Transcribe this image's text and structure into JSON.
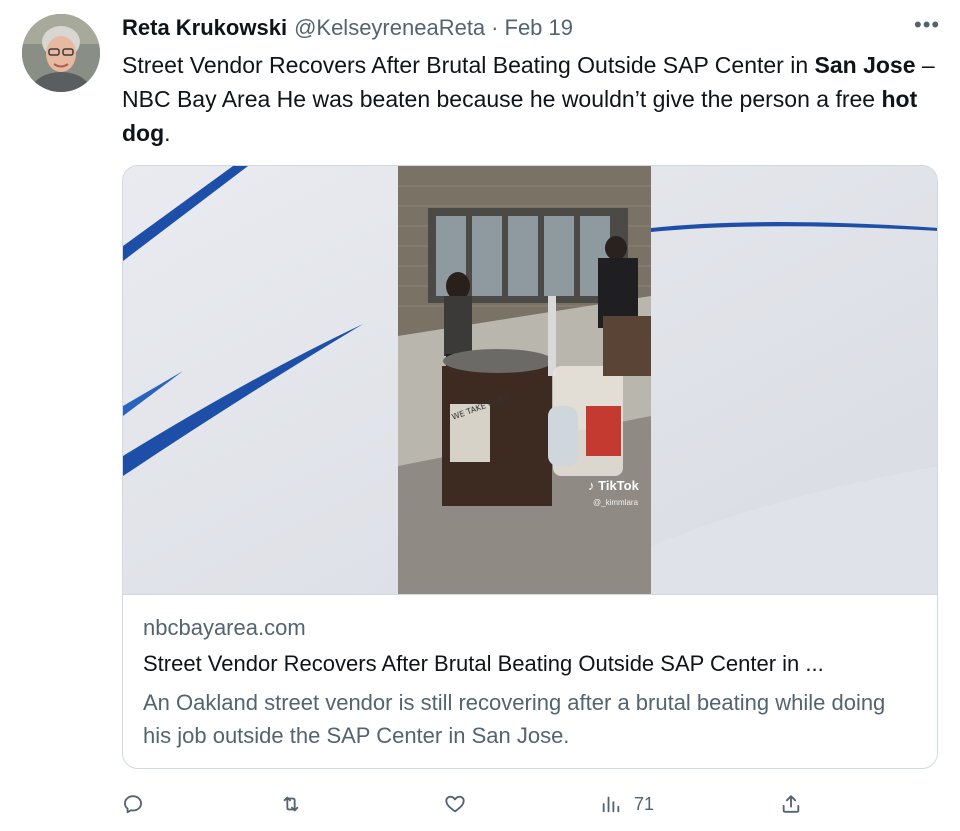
{
  "tweet": {
    "author_name": "Reta Krukowski",
    "author_handle": "@KelseyreneaReta",
    "separator": "·",
    "date": "Feb 19",
    "more_label": "•••",
    "text_parts": [
      {
        "text": "Street Vendor Recovers After Brutal Beating Outside SAP Center in ",
        "bold": false
      },
      {
        "text": "San Jose",
        "bold": true
      },
      {
        "text": " – NBC Bay Area He was beaten because he wouldn’t give the person a free ",
        "bold": false
      },
      {
        "text": "hot dog",
        "bold": true
      },
      {
        "text": ".",
        "bold": false
      }
    ]
  },
  "card": {
    "domain": "nbcbayarea.com",
    "title": "Street Vendor Recovers After Brutal Beating Outside SAP Center in ...",
    "description": "An Oakland street vendor is still recovering after a brutal beating while doing his job outside the SAP Center in San Jose.",
    "media": {
      "watermark_brand": "TikTok",
      "watermark_user": "@_kimmlara",
      "cart_sign": "WE TAKE CARD"
    }
  },
  "actions": {
    "reply_icon": "reply-icon",
    "retweet_icon": "retweet-icon",
    "like_icon": "heart-icon",
    "views_icon": "views-chart-icon",
    "views_count": "71",
    "share_icon": "share-icon"
  },
  "colors": {
    "text_primary": "#0f1419",
    "text_secondary": "#536471",
    "border": "#cfd9de",
    "accent_blue": "#1d4fa8"
  }
}
